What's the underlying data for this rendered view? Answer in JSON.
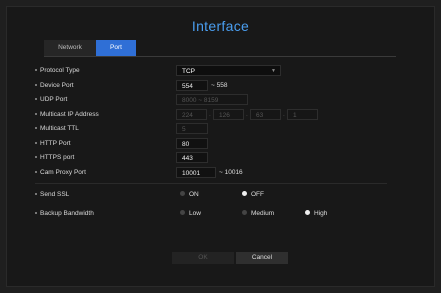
{
  "title": "Interface",
  "tabs": [
    {
      "label": "Network",
      "active": false
    },
    {
      "label": "Port",
      "active": true
    }
  ],
  "fields": {
    "protocol_type": {
      "label": "Protocol Type",
      "value": "TCP"
    },
    "device_port": {
      "label": "Device Port",
      "value": "554",
      "range_end": "~ 558"
    },
    "udp_port": {
      "label": "UDP Port",
      "value": "8000 ~ 8159"
    },
    "multicast_ip": {
      "label": "Multicast IP Address",
      "octets": [
        "224",
        "126",
        "63",
        "1"
      ],
      "separator": "."
    },
    "multicast_ttl": {
      "label": "Multicast TTL",
      "value": "5"
    },
    "http_port": {
      "label": "HTTP Port",
      "value": "80"
    },
    "https_port": {
      "label": "HTTPS port",
      "value": "443"
    },
    "cam_proxy_port": {
      "label": "Cam Proxy Port",
      "value": "10001",
      "range_end": "~ 10016"
    }
  },
  "send_ssl": {
    "label": "Send SSL",
    "options": [
      "ON",
      "OFF"
    ],
    "selected": "OFF"
  },
  "backup_bandwidth": {
    "label": "Backup Bandwidth",
    "options": [
      "Low",
      "Medium",
      "High"
    ],
    "selected": "High"
  },
  "buttons": {
    "ok": "OK",
    "cancel": "Cancel"
  },
  "colors": {
    "accent": "#2f6fd6",
    "title": "#4a9ef0"
  }
}
